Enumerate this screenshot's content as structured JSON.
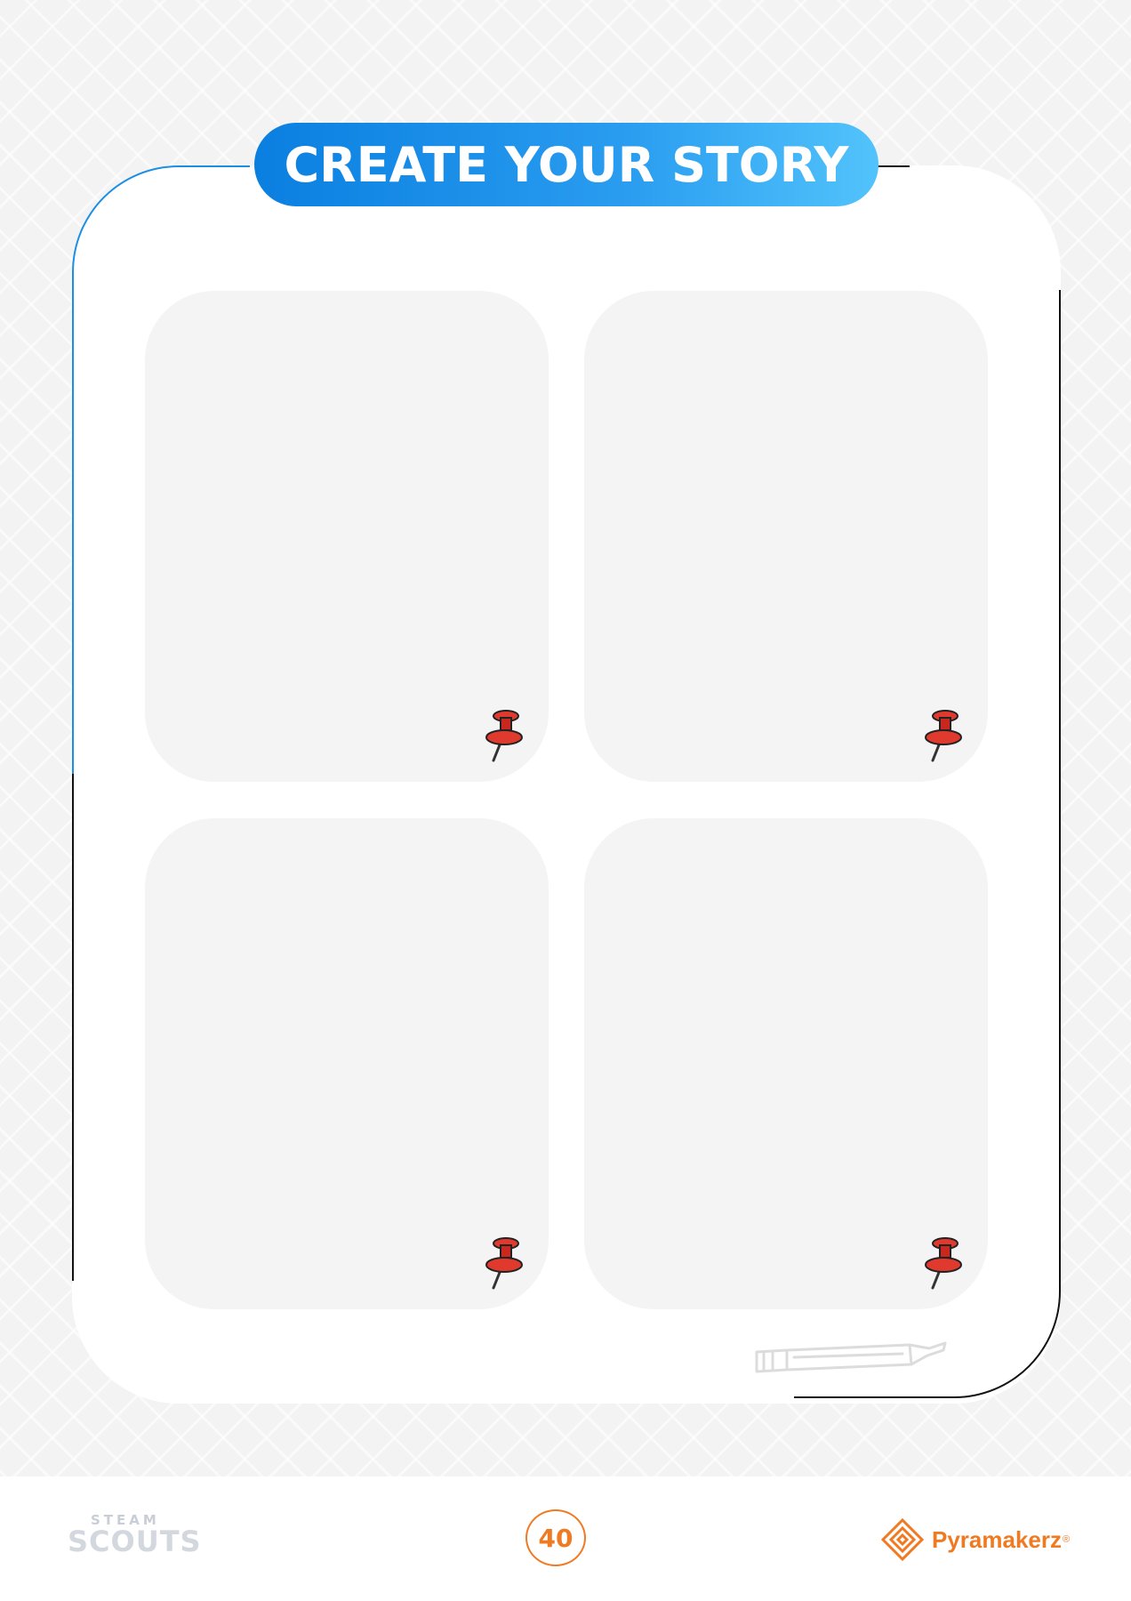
{
  "page": {
    "title": "CREATE YOUR STORY",
    "page_number": "40"
  },
  "panels": [
    {
      "id": "panel-1",
      "pin_icon": "pushpin-icon"
    },
    {
      "id": "panel-2",
      "pin_icon": "pushpin-icon"
    },
    {
      "id": "panel-3",
      "pin_icon": "pushpin-icon"
    },
    {
      "id": "panel-4",
      "pin_icon": "pushpin-icon"
    }
  ],
  "footer": {
    "left_logo_top": "STEAM",
    "left_logo_main": "SCOUTS",
    "right_logo_text": "Pyramakerz",
    "right_logo_mark": "®"
  },
  "colors": {
    "title_gradient_start": "#0a7fe0",
    "title_gradient_end": "#52c3fb",
    "panel_fill": "#f4f4f4",
    "accent_orange": "#f07a22",
    "pin_red": "#e03a2f"
  }
}
